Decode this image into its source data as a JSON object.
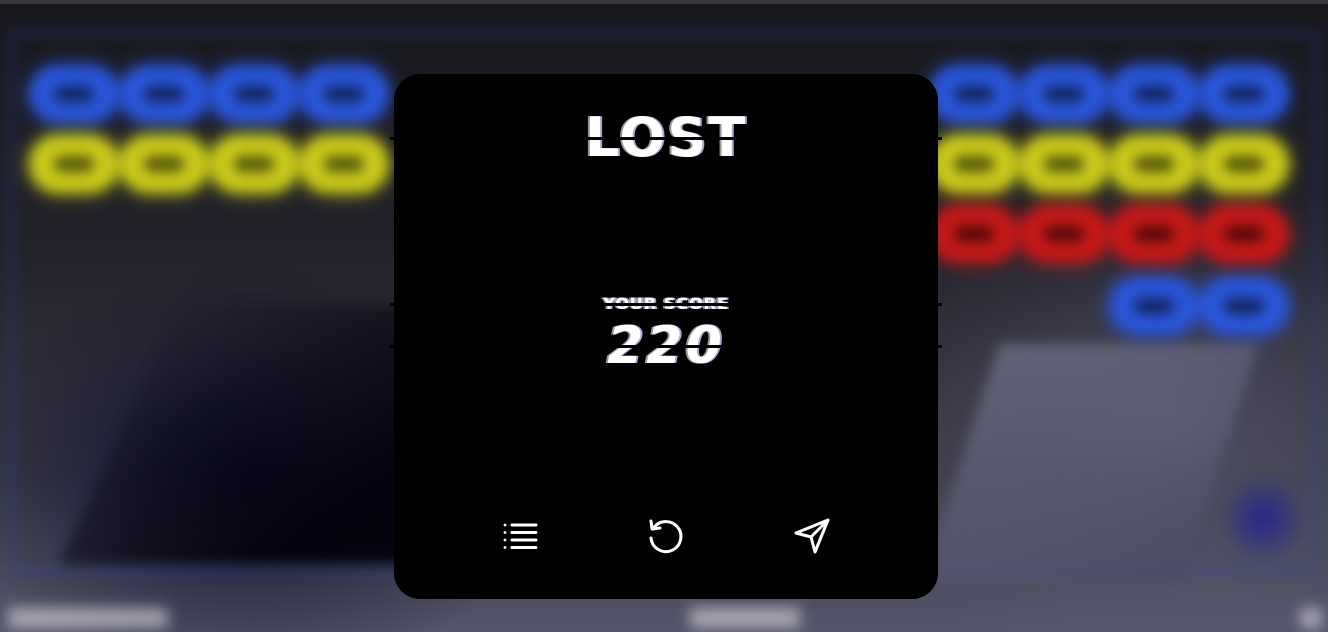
{
  "game": {
    "result_title": "LOST",
    "score_label": "YOUR SCORE",
    "score_value": "220"
  },
  "actions": {
    "menu_icon": "list-icon",
    "restart_icon": "restart-icon",
    "share_icon": "send-icon"
  },
  "colors": {
    "modal_background": "#000000",
    "text": "#ffffff",
    "brick_blue": "#2a55d8",
    "brick_yellow": "#c8c81a",
    "brick_red": "#c41818"
  }
}
